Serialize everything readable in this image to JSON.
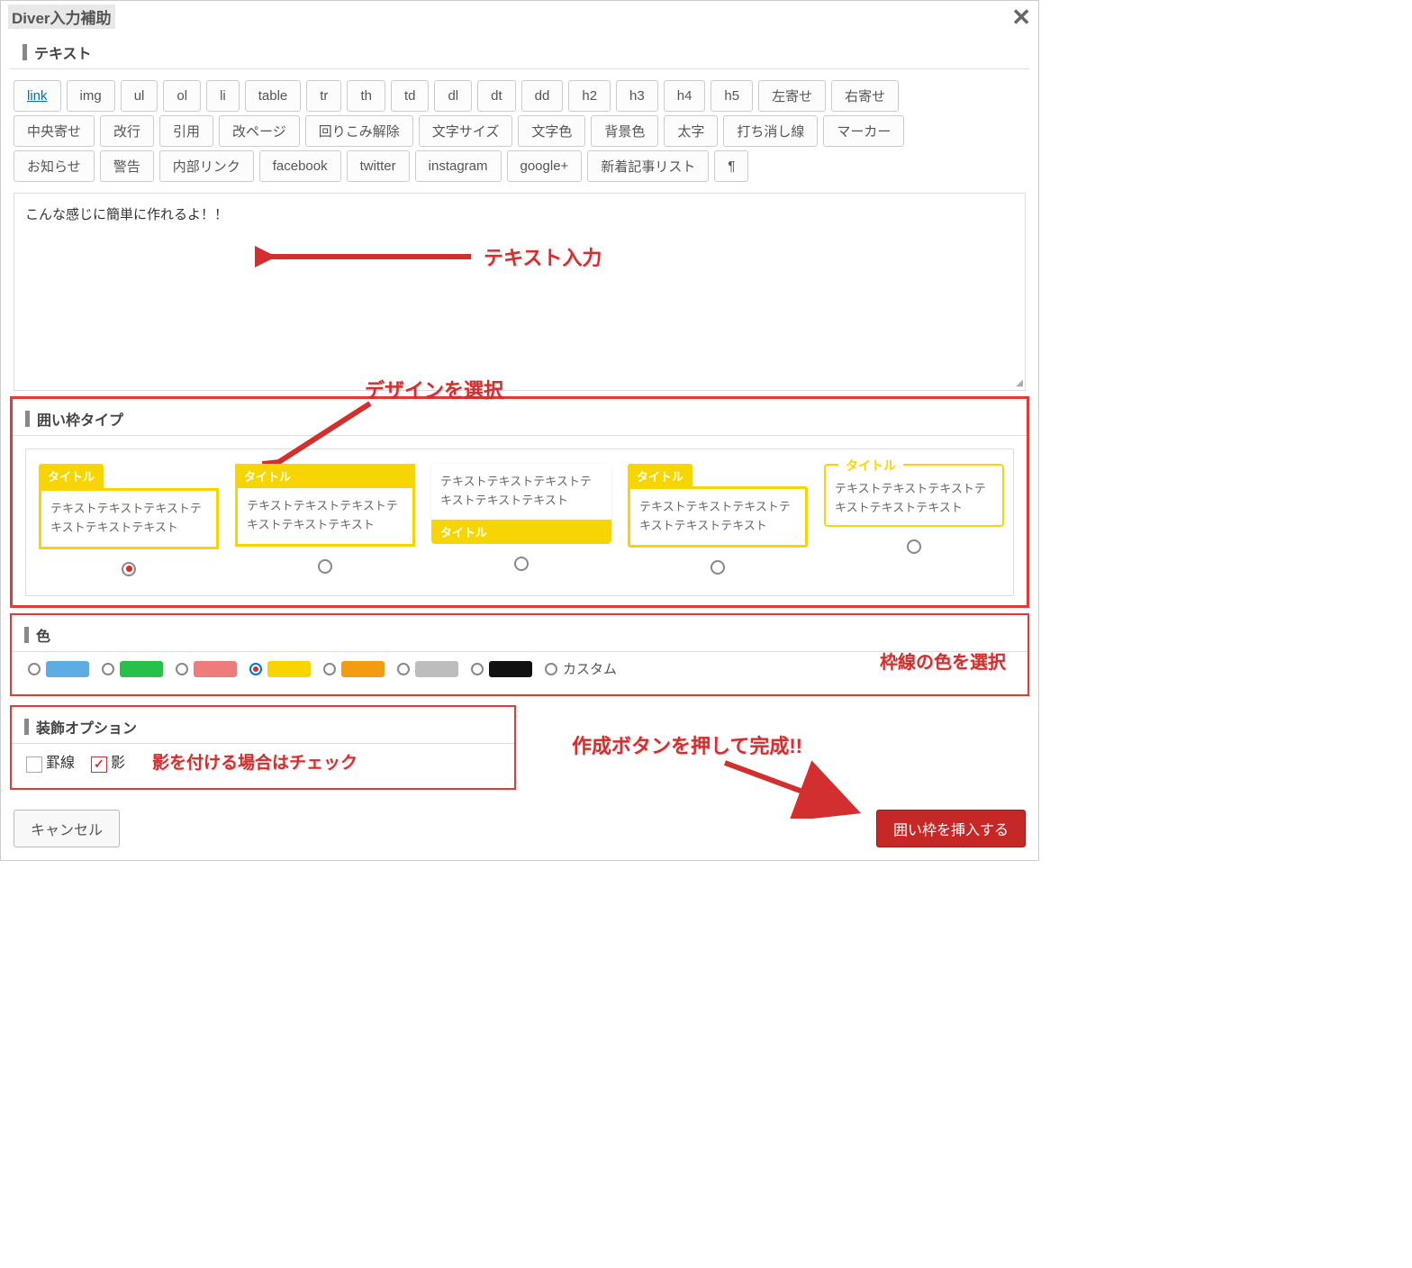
{
  "dialog": {
    "title": "Diver入力補助"
  },
  "sections": {
    "text": "テキスト",
    "frame_type": "囲い枠タイプ",
    "color": "色",
    "decoration": "装飾オプション"
  },
  "toolbar": {
    "row1": [
      "link",
      "img",
      "ul",
      "ol",
      "li",
      "table",
      "tr",
      "th",
      "td",
      "dl",
      "dt",
      "dd",
      "h2",
      "h3",
      "h4",
      "h5",
      "左寄せ",
      "右寄せ"
    ],
    "row2": [
      "中央寄せ",
      "改行",
      "引用",
      "改ページ",
      "回りこみ解除",
      "文字サイズ",
      "文字色",
      "背景色",
      "太字",
      "打ち消し線",
      "マーカー"
    ],
    "row3": [
      "お知らせ",
      "警告",
      "内部リンク",
      "facebook",
      "twitter",
      "instagram",
      "google+",
      "新着記事リスト",
      "¶"
    ]
  },
  "text_input": {
    "value": "こんな感じに簡単に作れるよ！！"
  },
  "frame_preview": {
    "title": "タイトル",
    "body": "テキストテキストテキストテキストテキストテキスト",
    "selected_index": 0
  },
  "colors": {
    "items": [
      {
        "hex": "#5dade2"
      },
      {
        "hex": "#27c04a"
      },
      {
        "hex": "#ef7c7c"
      },
      {
        "hex": "#f7d500",
        "selected": true
      },
      {
        "hex": "#f39c12"
      },
      {
        "hex": "#bdbdbd"
      },
      {
        "hex": "#111111"
      }
    ],
    "custom_label": "カスタム"
  },
  "decoration": {
    "items": [
      {
        "label": "罫線",
        "checked": false
      },
      {
        "label": "影",
        "checked": true
      }
    ]
  },
  "footer": {
    "cancel": "キャンセル",
    "insert": "囲い枠を挿入する"
  },
  "annotations": {
    "text_input": "テキスト入力",
    "design_select": "デザインを選択",
    "color_select": "枠線の色を選択",
    "shadow_check": "影を付ける場合はチェック",
    "create_done": "作成ボタンを押して完成!!"
  }
}
